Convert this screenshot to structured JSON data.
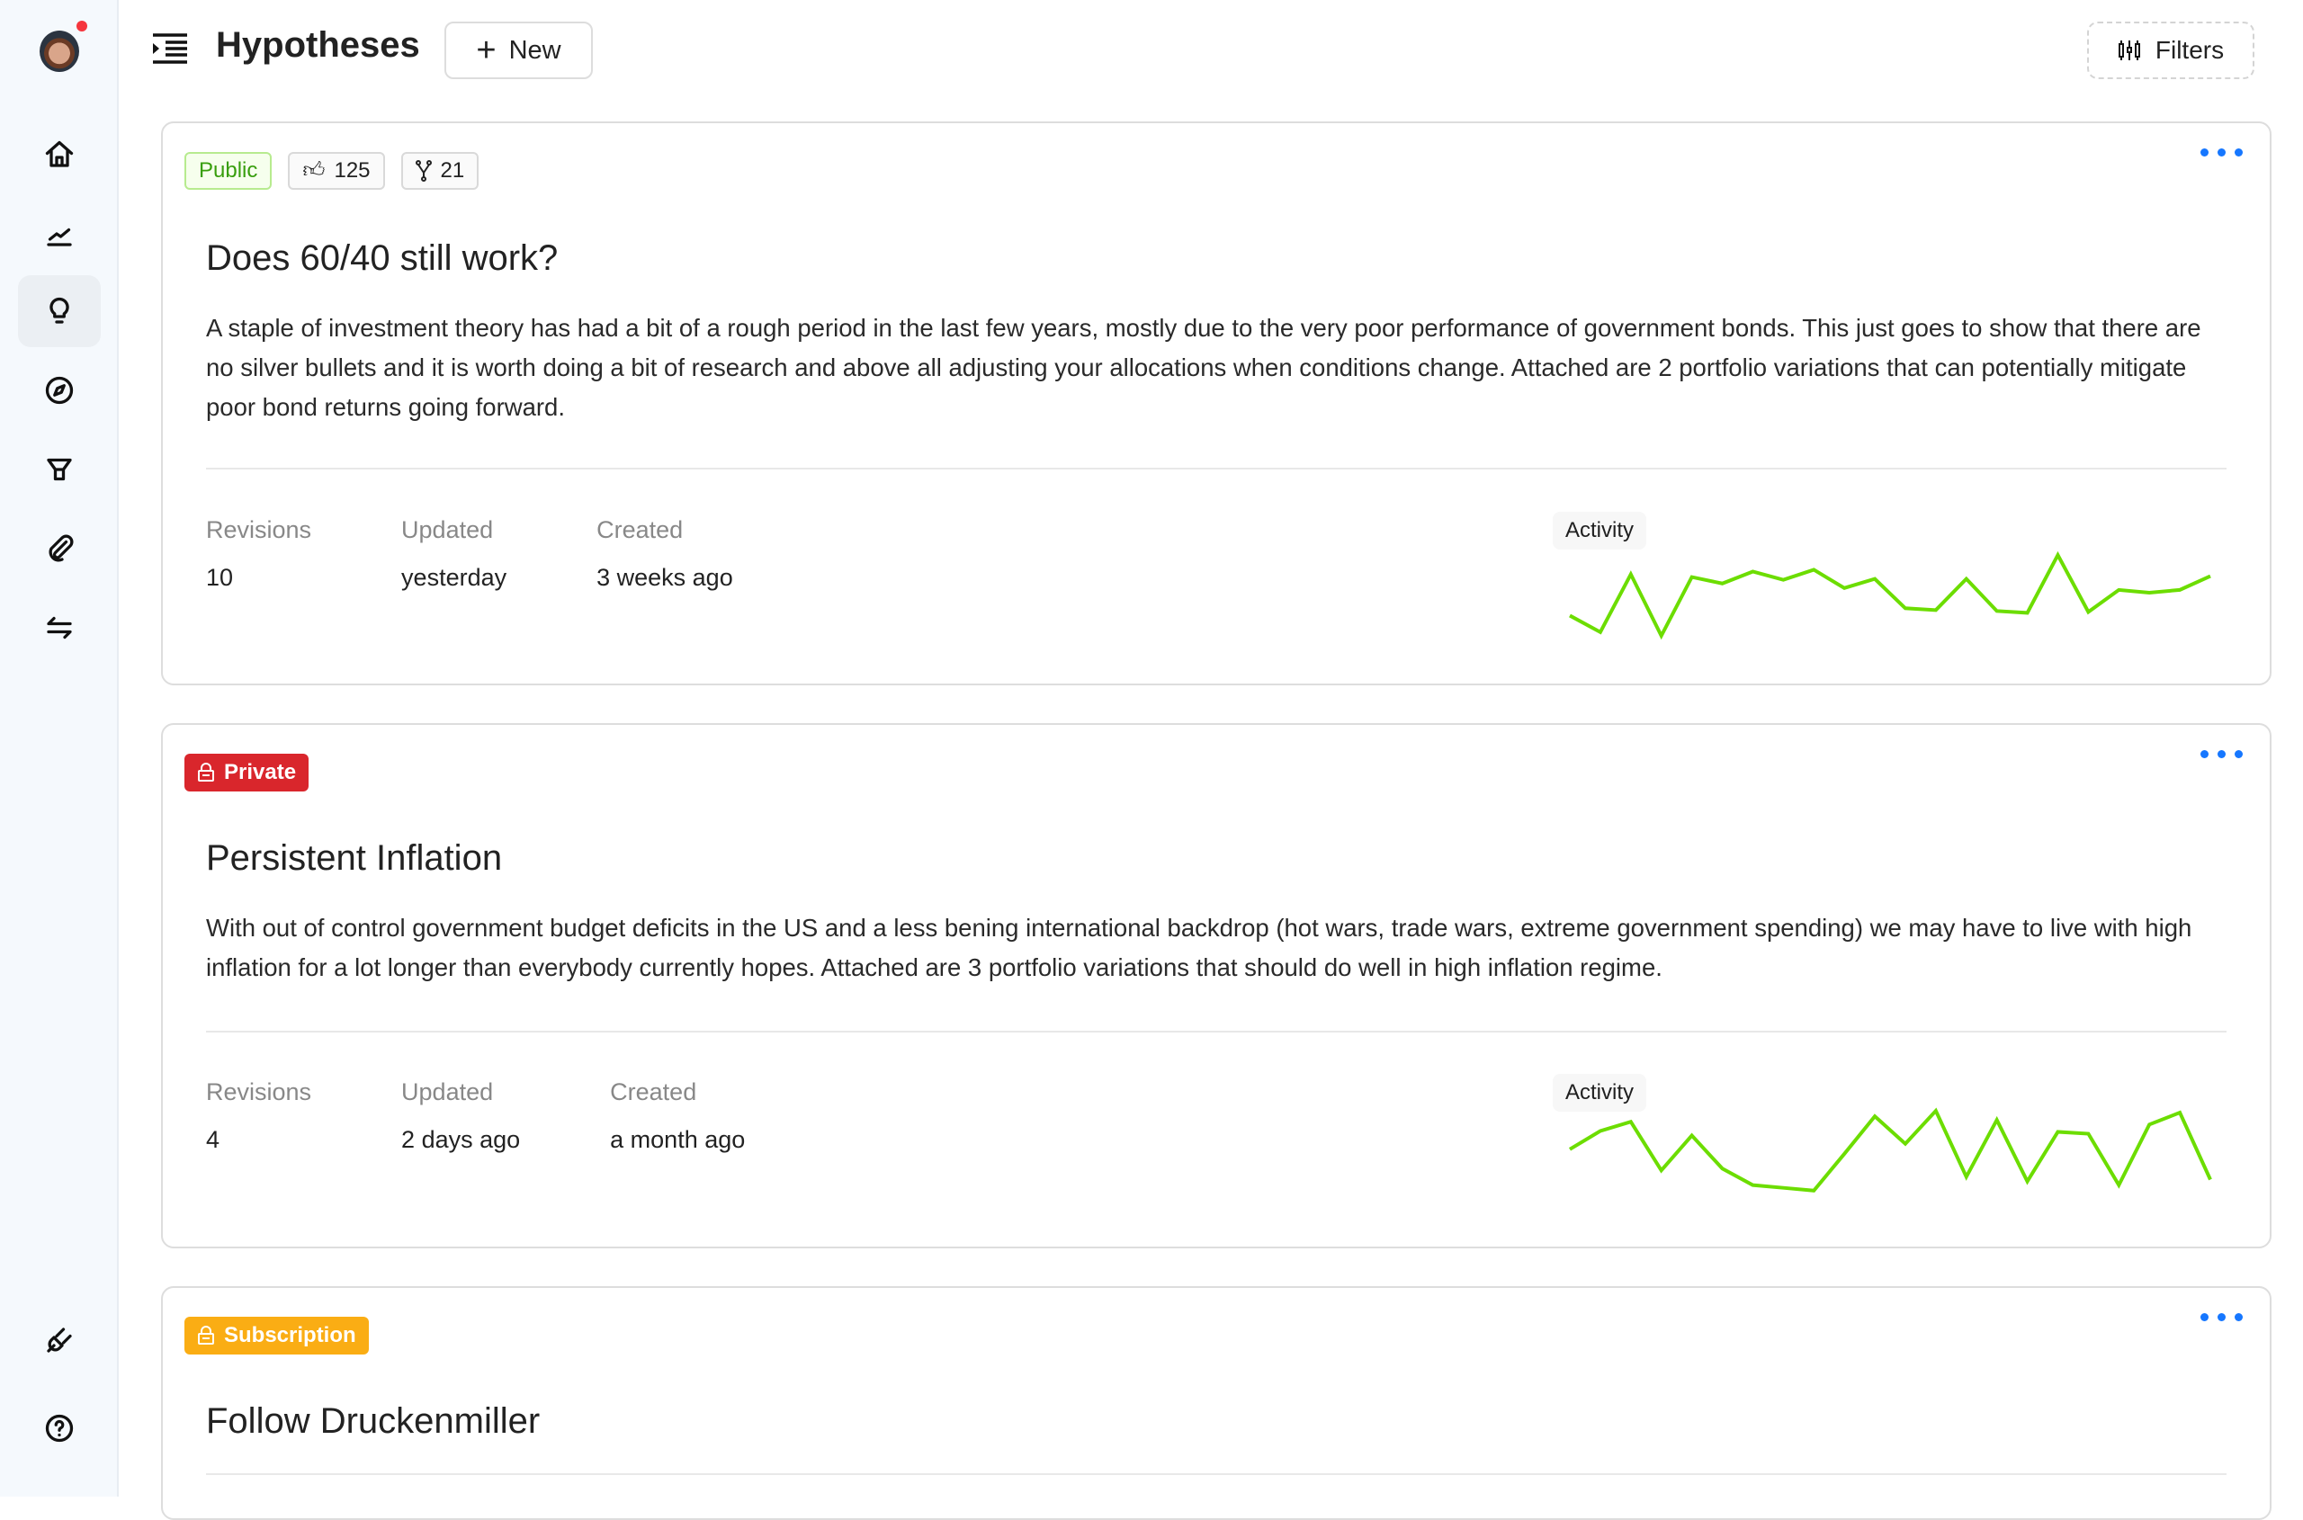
{
  "header": {
    "title": "Hypotheses",
    "new_label": "New",
    "filters_label": "Filters"
  },
  "sidebar": {
    "items": [
      "home",
      "chart",
      "hypotheses",
      "explore",
      "funnel",
      "attachments",
      "transfers"
    ],
    "active": "hypotheses",
    "bottom": [
      "plugin",
      "help"
    ],
    "notification": true
  },
  "colors": {
    "accent": "#1677ff",
    "spark": "#6cdd00",
    "private": "#d9262c",
    "subscription": "#faad14",
    "public": "#389e0d"
  },
  "cards": [
    {
      "badge": "Public",
      "likes": "125",
      "forks": "21",
      "title": "Does 60/40 still work?",
      "body": "A staple of investment theory has had a bit of a rough period in the last few years, mostly due to the very poor performance of government bonds. This just goes to show that there are no silver bullets and it is worth doing a bit of research and above all adjusting your allocations when conditions change. Attached are 2 portfolio variations that can potentially mitigate poor bond returns going forward.",
      "revisions_label": "Revisions",
      "revisions": "10",
      "updated_label": "Updated",
      "updated": "yesterday",
      "created_label": "Created",
      "created": "3 weeks ago",
      "activity_label": "Activity",
      "activity": [
        28,
        10,
        73,
        6,
        70,
        63,
        76,
        67,
        78,
        58,
        68,
        36,
        34,
        68,
        33,
        31,
        94,
        32,
        56,
        53,
        56,
        71
      ]
    },
    {
      "badge": "Private",
      "title": "Persistent Inflation",
      "body": "With out of control government budget deficits in the US and a less bening international backdrop (hot wars, trade wars, extreme government spending) we may have to live with high inflation for a lot longer than everybody currently hopes. Attached are 3 portfolio variations that should do well in high inflation regime.",
      "revisions_label": "Revisions",
      "revisions": "4",
      "updated_label": "Updated",
      "updated": "2 days ago",
      "created_label": "Created",
      "created": "a month ago",
      "activity_label": "Activity",
      "activity": [
        58,
        78,
        88,
        35,
        73,
        37,
        19,
        16,
        13,
        53,
        94,
        64,
        100,
        28,
        90,
        23,
        77,
        75,
        19,
        85,
        98,
        25
      ]
    },
    {
      "badge": "Subscription",
      "title": "Follow Druckenmiller"
    }
  ]
}
